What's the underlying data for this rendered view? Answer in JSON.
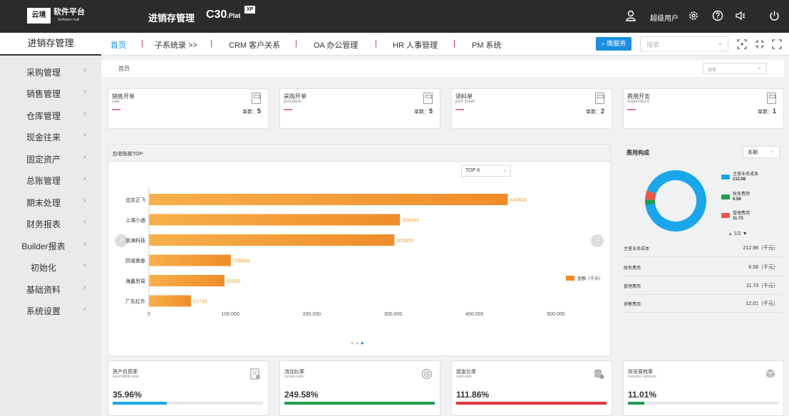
{
  "header": {
    "logo_mark": "云境",
    "logo_title": "软件平台",
    "logo_sub": "Software mall",
    "app_title": "进销存管理",
    "product": "C30",
    "product_suffix": ".Plat",
    "badge": "XP",
    "user_label": "超级用户",
    "icons": [
      "user-icon",
      "settings-icon",
      "help-icon",
      "speaker-icon",
      "power-icon"
    ]
  },
  "nav": {
    "module": "进销存管理",
    "tabs": [
      "首页",
      "子系统录 >>",
      "CRM 客户关系",
      "OA 办公管理",
      "HR 人事管理",
      "PM 系统"
    ],
    "service_button": "微服务",
    "search_placeholder": "搜索"
  },
  "sidebar": {
    "items": [
      "采购管理",
      "销售管理",
      "仓库管理",
      "现金往来",
      "固定资产",
      "总账管理",
      "期末处理",
      "财务报表",
      "Builder报表",
      "初始化",
      "基础资料",
      "系统设置"
    ]
  },
  "breadcrumb": {
    "label": "首页",
    "search_placeholder": "搜索"
  },
  "kpis": [
    {
      "title": "销售开单",
      "sub": "sale",
      "dash": "—",
      "count_label": "单数：",
      "count": "5"
    },
    {
      "title": "采购开单",
      "sub": "purchase",
      "dash": "—",
      "count_label": "单数：",
      "count": "5"
    },
    {
      "title": "领料单",
      "sub": "pick sheet",
      "dash": "—",
      "count_label": "单数：",
      "count": "2"
    },
    {
      "title": "费用开支",
      "sub": "expenditure",
      "dash": "—",
      "count_label": "单数：",
      "count": "1"
    }
  ],
  "receivables": {
    "title": "应收账款TOP",
    "top_select": "TOP 6",
    "prev": "‹",
    "next": "›"
  },
  "chart_data": {
    "type": "bar",
    "orientation": "horizontal",
    "categories": [
      "北京正飞",
      "上海小通",
      "浙海科技",
      "四海普泰",
      "海鑫贸易",
      "广东红升"
    ],
    "values": [
      440800,
      308444,
      301600,
      100688,
      92800,
      51738
    ],
    "series": [
      {
        "name": "金额（千元）",
        "values": [
          440800,
          308444,
          301600,
          100688,
          92800,
          51738
        ]
      }
    ],
    "xticks": [
      "0",
      "100,000",
      "200,000",
      "300,000",
      "400,000",
      "500,000"
    ],
    "xlim": [
      0,
      500000
    ],
    "legend_position": "right",
    "color_start": "#f6b04a",
    "color_end": "#f08c2a"
  },
  "expense": {
    "title": "费用构成",
    "period": "本期",
    "legend": [
      {
        "name": "主营业务成本",
        "value": "212.98",
        "color": "#1aa6ea"
      },
      {
        "name": "财务费用",
        "value": "6.58",
        "color": "#1f9c4d"
      },
      {
        "name": "管理费用",
        "value": "11.73",
        "color": "#e8564e"
      }
    ],
    "pager": "1/2",
    "rows": [
      {
        "name": "主营业务成本",
        "value": "212.98（千元）"
      },
      {
        "name": "财务费用",
        "value": "6.58（千元）"
      },
      {
        "name": "管理费用",
        "value": "11.73（千元）"
      },
      {
        "name": "销售费用",
        "value": "12.01（千元）"
      }
    ],
    "donut_values": [
      212.98,
      6.58,
      11.73
    ]
  },
  "ratios": [
    {
      "title": "资产负债率",
      "sub": "asset libility ratio",
      "value": "35.96%",
      "fraction": 0.3596,
      "color": "#1aa6ea",
      "icon": "document-icon"
    },
    {
      "title": "流动比率",
      "sub": "current ratio",
      "value": "249.58%",
      "fraction": 1.0,
      "color": "#1f9c4d",
      "icon": "target-icon"
    },
    {
      "title": "现金比率",
      "sub": "cash ratio",
      "value": "111.86%",
      "fraction": 1.0,
      "color": "#e0353b",
      "icon": "database-icon"
    },
    {
      "title": "存货周转率",
      "sub": "inventory turnover",
      "value": "11.01%",
      "fraction": 0.1101,
      "color": "#1f9c4d",
      "icon": "cube-icon"
    }
  ]
}
